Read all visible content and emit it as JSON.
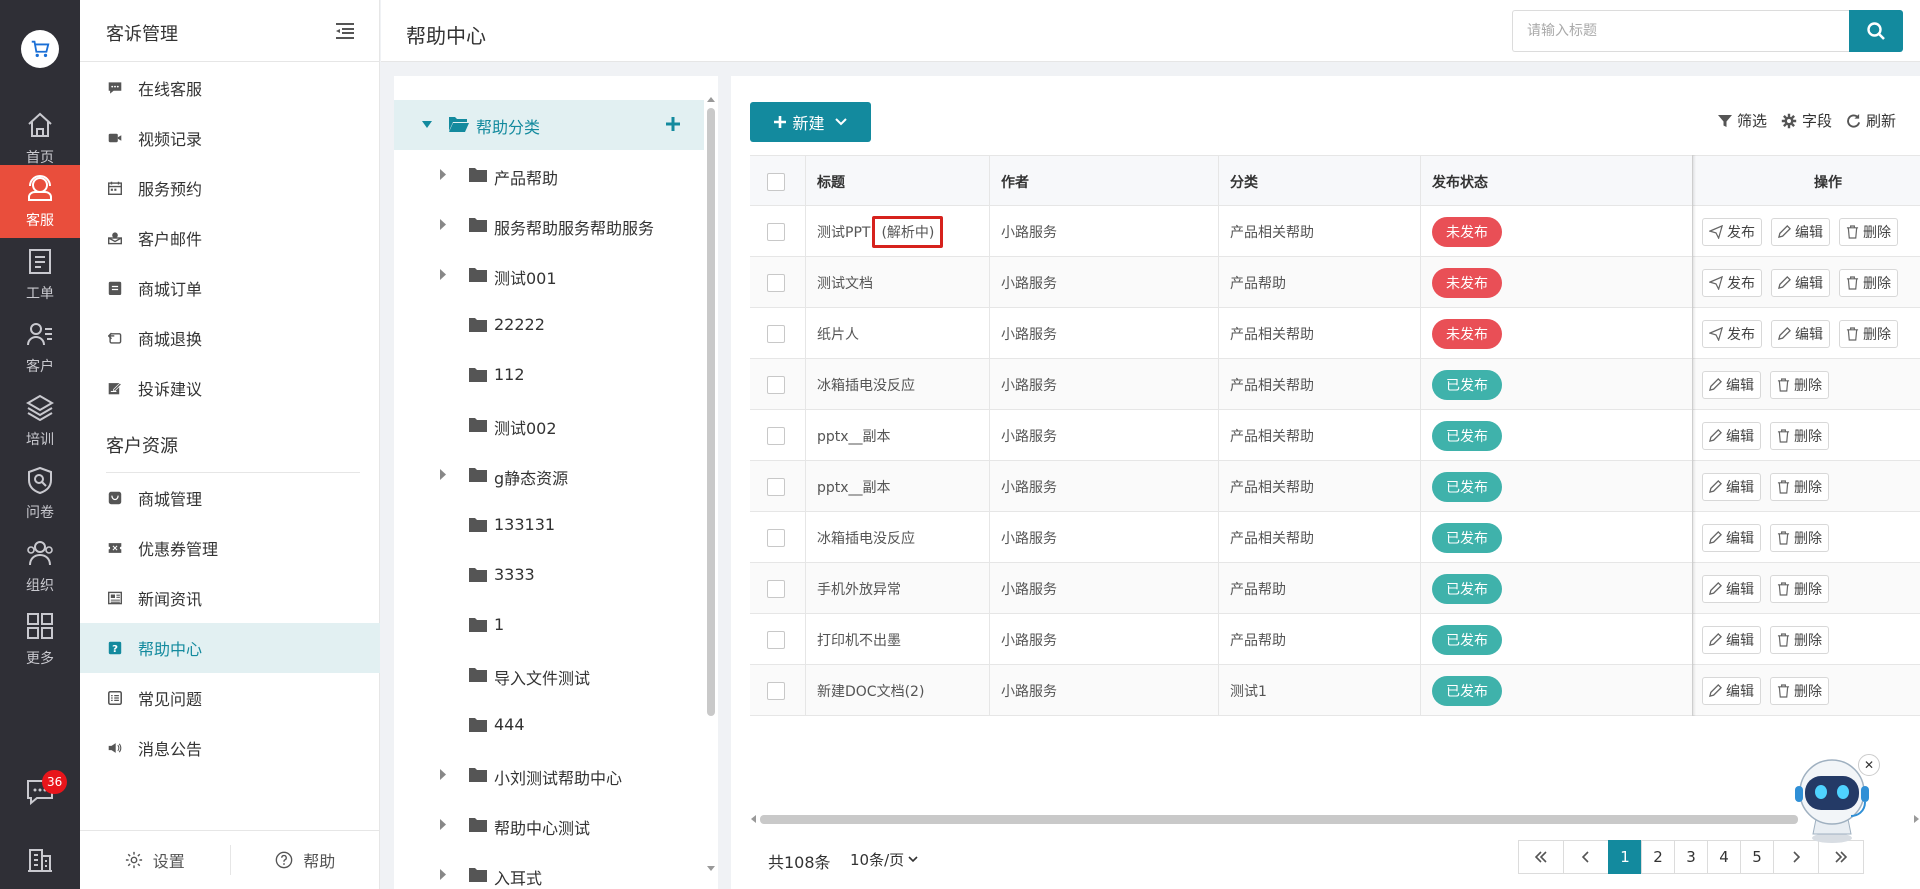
{
  "rail": {
    "items": [
      {
        "label": "首页",
        "icon": "home-icon"
      },
      {
        "label": "客服",
        "icon": "headset-icon",
        "active": true
      },
      {
        "label": "工单",
        "icon": "clipboard-icon"
      },
      {
        "label": "客户",
        "icon": "user-card-icon"
      },
      {
        "label": "培训",
        "icon": "layers-icon"
      },
      {
        "label": "问卷",
        "icon": "shield-search-icon"
      },
      {
        "label": "组织",
        "icon": "group-icon"
      },
      {
        "label": "更多",
        "icon": "grid-icon"
      }
    ],
    "chat_badge": "36"
  },
  "sidebar": {
    "section1_title": "客诉管理",
    "section1_items": [
      {
        "label": "在线客服",
        "icon": "chat-icon"
      },
      {
        "label": "视频记录",
        "icon": "video-icon"
      },
      {
        "label": "服务预约",
        "icon": "calendar-icon"
      },
      {
        "label": "客户邮件",
        "icon": "mail-icon"
      },
      {
        "label": "商城订单",
        "icon": "order-icon"
      },
      {
        "label": "商城退换",
        "icon": "return-icon"
      },
      {
        "label": "投诉建议",
        "icon": "edit-note-icon"
      }
    ],
    "section2_title": "客户资源",
    "section2_items": [
      {
        "label": "商城管理",
        "icon": "shop-icon"
      },
      {
        "label": "优惠券管理",
        "icon": "coupon-icon"
      },
      {
        "label": "新闻资讯",
        "icon": "news-icon"
      },
      {
        "label": "帮助中心",
        "icon": "help-icon",
        "active": true
      },
      {
        "label": "常见问题",
        "icon": "list-icon"
      },
      {
        "label": "消息公告",
        "icon": "speaker-icon"
      }
    ],
    "footer": {
      "settings": "设置",
      "help": "帮助"
    }
  },
  "header": {
    "title": "帮助中心",
    "search_placeholder": "请输入标题"
  },
  "tree": {
    "root": "帮助分类",
    "nodes": [
      {
        "label": "产品帮助",
        "expandable": true
      },
      {
        "label": "服务帮助服务帮助服务",
        "expandable": true
      },
      {
        "label": "测试001",
        "expandable": true
      },
      {
        "label": "22222",
        "expandable": false
      },
      {
        "label": "112",
        "expandable": false
      },
      {
        "label": "测试002",
        "expandable": false
      },
      {
        "label": "g静态资源",
        "expandable": true
      },
      {
        "label": "133131",
        "expandable": false
      },
      {
        "label": "3333",
        "expandable": false
      },
      {
        "label": "1",
        "expandable": false
      },
      {
        "label": "导入文件测试",
        "expandable": false
      },
      {
        "label": "444",
        "expandable": false
      },
      {
        "label": "小刘测试帮助中心",
        "expandable": true
      },
      {
        "label": "帮助中心测试",
        "expandable": true
      },
      {
        "label": "入耳式",
        "expandable": true
      }
    ]
  },
  "toolbar": {
    "new_label": "新建",
    "filter": "筛选",
    "fields": "字段",
    "refresh": "刷新"
  },
  "table": {
    "columns": [
      "标题",
      "作者",
      "分类",
      "发布状态",
      "操作"
    ],
    "rows": [
      {
        "title": "测试PPT",
        "tag": "(解析中)",
        "author": "小路服务",
        "category": "产品相关帮助",
        "status": "未发布",
        "published": false
      },
      {
        "title": "测试文档",
        "author": "小路服务",
        "category": "产品帮助",
        "status": "未发布",
        "published": false
      },
      {
        "title": "纸片人",
        "author": "小路服务",
        "category": "产品相关帮助",
        "status": "未发布",
        "published": false
      },
      {
        "title": "冰箱插电没反应",
        "author": "小路服务",
        "category": "产品相关帮助",
        "status": "已发布",
        "published": true
      },
      {
        "title": "pptx__副本",
        "author": "小路服务",
        "category": "产品相关帮助",
        "status": "已发布",
        "published": true
      },
      {
        "title": "pptx__副本",
        "author": "小路服务",
        "category": "产品相关帮助",
        "status": "已发布",
        "published": true
      },
      {
        "title": "冰箱插电没反应",
        "author": "小路服务",
        "category": "产品相关帮助",
        "status": "已发布",
        "published": true
      },
      {
        "title": "手机外放异常",
        "author": "小路服务",
        "category": "产品帮助",
        "status": "已发布",
        "published": true
      },
      {
        "title": "打印机不出墨",
        "author": "小路服务",
        "category": "产品帮助",
        "status": "已发布",
        "published": true
      },
      {
        "title": "新建DOC文档(2)",
        "author": "小路服务",
        "category": "测试1",
        "status": "已发布",
        "published": true
      }
    ],
    "actions": {
      "publish": "发布",
      "edit": "编辑",
      "delete": "删除"
    }
  },
  "pagination": {
    "total": "共108条",
    "per_page": "10条/页",
    "pages": [
      "1",
      "2",
      "3",
      "4",
      "5"
    ],
    "current": "1"
  },
  "colors": {
    "accent": "#138a9e",
    "rail_active": "#e94e3c",
    "unpublished": "#e94f56",
    "published": "#3fb2ab"
  }
}
